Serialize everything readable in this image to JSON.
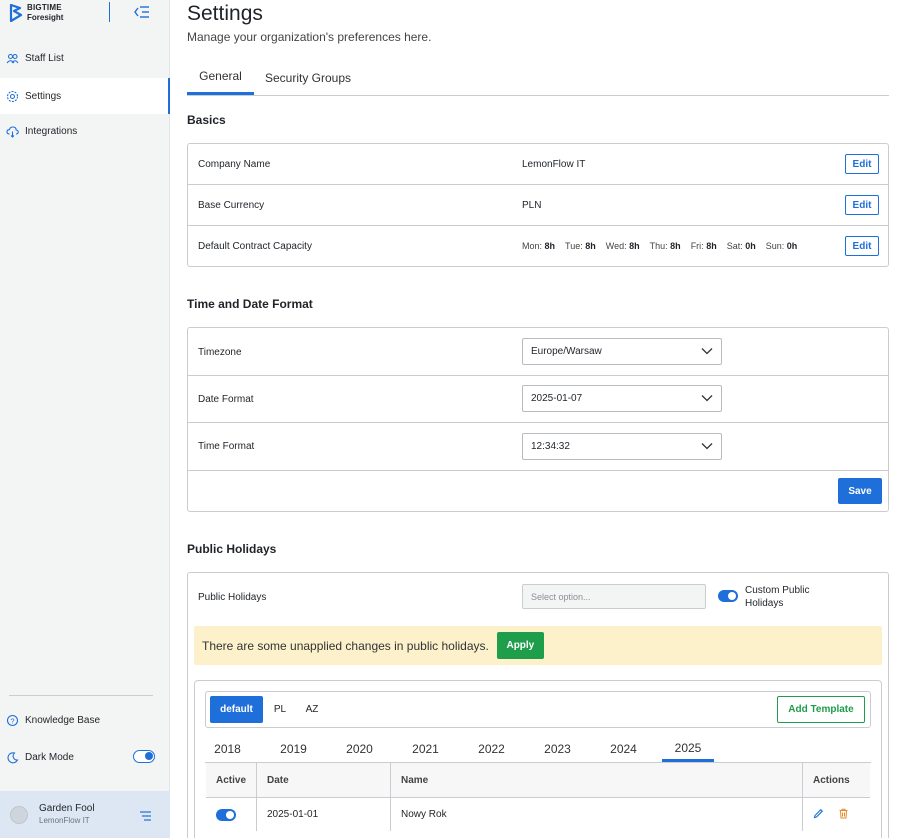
{
  "brand": {
    "line1": "BIGTIME",
    "line2": "Foresight"
  },
  "sidebar": {
    "items": [
      {
        "label": "Staff List",
        "icon": "users-icon"
      },
      {
        "label": "Settings",
        "icon": "gear-icon"
      },
      {
        "label": "Integrations",
        "icon": "cloud-icon"
      }
    ],
    "bottom": [
      {
        "label": "Knowledge Base",
        "icon": "help-icon"
      },
      {
        "label": "Dark Mode",
        "icon": "moon-icon",
        "toggle": "on"
      }
    ],
    "user": {
      "name": "Garden Fool",
      "company": "LemonFlow IT"
    }
  },
  "page": {
    "title": "Settings",
    "subtitle": "Manage your organization's preferences here."
  },
  "tabs": [
    {
      "label": "General",
      "active": true
    },
    {
      "label": "Security Groups",
      "active": false
    }
  ],
  "basics": {
    "title": "Basics",
    "edit_label": "Edit",
    "company_name": {
      "label": "Company Name",
      "value": "LemonFlow IT"
    },
    "base_currency": {
      "label": "Base Currency",
      "value": "PLN"
    },
    "capacity": {
      "label": "Default Contract Capacity",
      "days": [
        {
          "day": "Mon:",
          "hours": "8h"
        },
        {
          "day": "Tue:",
          "hours": "8h"
        },
        {
          "day": "Wed:",
          "hours": "8h"
        },
        {
          "day": "Thu:",
          "hours": "8h"
        },
        {
          "day": "Fri:",
          "hours": "8h"
        },
        {
          "day": "Sat:",
          "hours": "0h"
        },
        {
          "day": "Sun:",
          "hours": "0h"
        }
      ]
    }
  },
  "time_date": {
    "title": "Time and Date Format",
    "timezone": {
      "label": "Timezone",
      "value": "Europe/Warsaw"
    },
    "date_format": {
      "label": "Date Format",
      "value": "2025-01-07"
    },
    "time_format": {
      "label": "Time Format",
      "value": "12:34:32"
    },
    "save_label": "Save"
  },
  "holidays": {
    "title": "Public Holidays",
    "label": "Public Holidays",
    "select_placeholder": "Select option...",
    "custom_label_1": "Custom Public",
    "custom_label_2": "Holidays",
    "warning": "There are some unapplied changes in public holidays.",
    "apply_label": "Apply",
    "templates": [
      {
        "label": "default",
        "active": true
      },
      {
        "label": "PL"
      },
      {
        "label": "AZ"
      }
    ],
    "add_template_label": "Add Template",
    "years": [
      "2018",
      "2019",
      "2020",
      "2021",
      "2022",
      "2023",
      "2024",
      "2025"
    ],
    "active_year": "2025",
    "columns": {
      "active": "Active",
      "date": "Date",
      "name": "Name",
      "actions": "Actions"
    },
    "rows": [
      {
        "date": "2025-01-01",
        "name": "Nowy Rok",
        "active": true
      }
    ]
  },
  "colors": {
    "accent": "#1e6fd9",
    "success": "#1e9e4a",
    "warning_bg": "#fdf1cc",
    "delete": "#e8892a"
  }
}
